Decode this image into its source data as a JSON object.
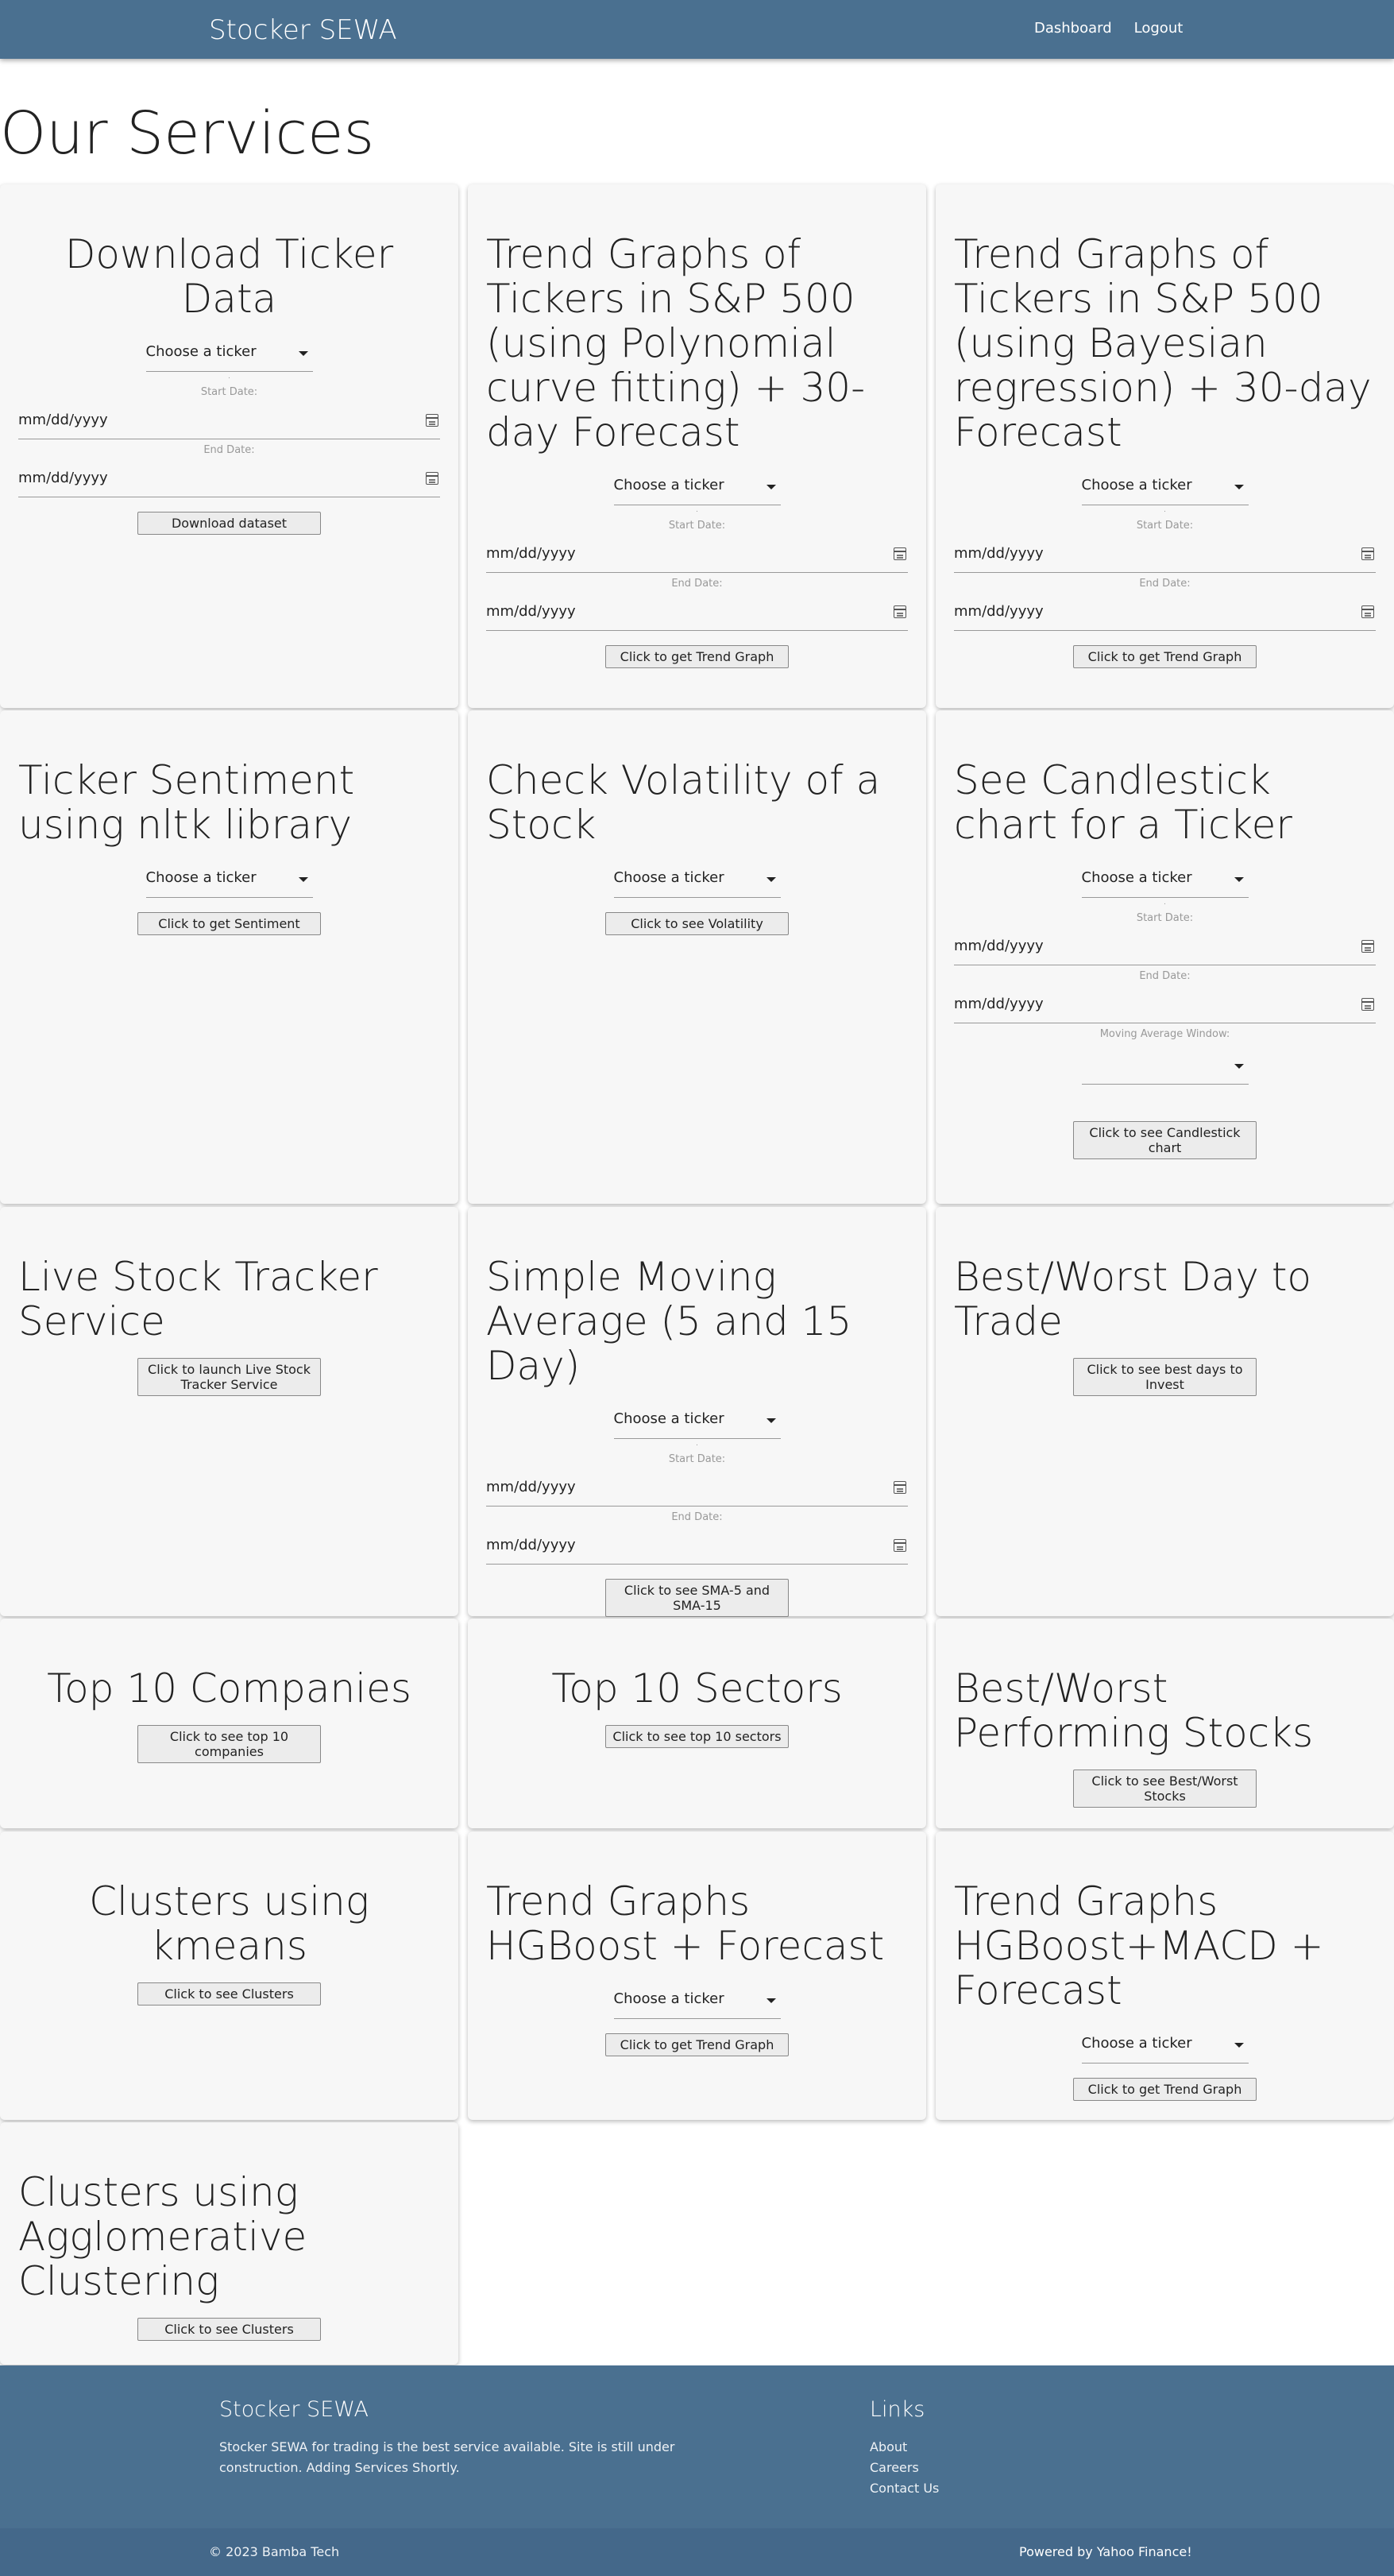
{
  "navbar": {
    "brand": "Stocker SEWA",
    "links": [
      "Dashboard",
      "Logout"
    ]
  },
  "page_title": "Our Services",
  "common": {
    "choose_ticker": "Choose a ticker",
    "date_placeholder": "mm/dd/yyyy",
    "start_date_label": "Start Date:",
    "end_date_label": "End Date:",
    "moving_average_label": "Moving Average Window:",
    "dot": "."
  },
  "cards": {
    "download": {
      "title": "Download Ticker Data",
      "button": "Download dataset"
    },
    "poly": {
      "title": "Trend Graphs of Tickers in S&P 500 (using Polynomial curve fitting) + 30-day Forecast",
      "button": "Click to get Trend Graph"
    },
    "bayes": {
      "title": "Trend Graphs of Tickers in S&P 500 (using Bayesian regression) + 30-day Forecast",
      "button": "Click to get Trend Graph"
    },
    "sentiment": {
      "title": "Ticker Sentiment using nltk library",
      "button": "Click to get Sentiment"
    },
    "volatility": {
      "title": "Check Volatility of a Stock",
      "button": "Click to see Volatility"
    },
    "candlestick": {
      "title": "See Candlestick chart for a Ticker",
      "button": "Click to see Candlestick chart"
    },
    "live": {
      "title": "Live Stock Tracker Service",
      "button": "Click to launch Live Stock Tracker Service"
    },
    "sma": {
      "title": "Simple Moving Average (5 and 15 Day)",
      "button": "Click to see SMA-5 and SMA-15"
    },
    "bestday": {
      "title": "Best/Worst Day to Trade",
      "button": "Click to see best days to Invest"
    },
    "top10companies": {
      "title": "Top 10 Companies",
      "button": "Click to see top 10 companies"
    },
    "top10sectors": {
      "title": "Top 10 Sectors",
      "button": "Click to see top 10 sectors"
    },
    "bestworst": {
      "title": "Best/Worst Performing Stocks",
      "button": "Click to see Best/Worst Stocks"
    },
    "kmeans": {
      "title": "Clusters using kmeans",
      "button": "Click to see Clusters"
    },
    "hgboost": {
      "title": "Trend Graphs HGBoost + Forecast",
      "button": "Click to get Trend Graph"
    },
    "hgboost_macd": {
      "title": "Trend Graphs HGBoost+MACD + Forecast",
      "button": "Click to get Trend Graph"
    },
    "agglomerative": {
      "title": "Clusters using Agglomerative Clustering",
      "button": "Click to see Clusters"
    }
  },
  "footer": {
    "brand": "Stocker SEWA",
    "description": "Stocker SEWA for trading is the best service available. Site is still under construction. Adding Services Shortly.",
    "links_title": "Links",
    "links": [
      "About",
      "Careers",
      "Contact Us"
    ],
    "copyright": "© 2023 Bamba Tech",
    "powered_by": "Powered by Yahoo Finance!"
  }
}
